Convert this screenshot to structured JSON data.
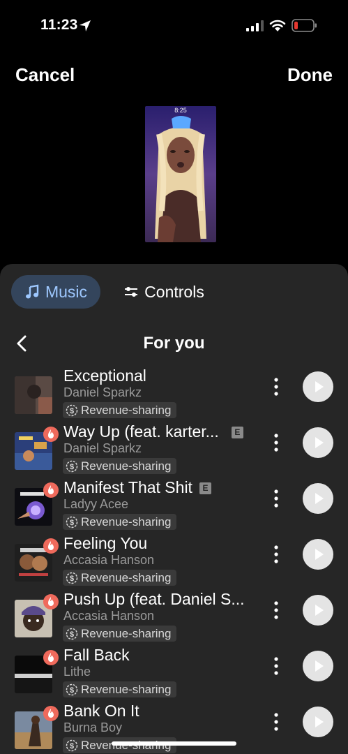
{
  "status_bar": {
    "time": "11:23"
  },
  "header": {
    "cancel_label": "Cancel",
    "done_label": "Done"
  },
  "preview": {
    "clock_text": "8:25"
  },
  "tabs": [
    {
      "label": "Music",
      "icon": "music-note-icon",
      "active": true
    },
    {
      "label": "Controls",
      "icon": "sliders-icon",
      "active": false
    }
  ],
  "list": {
    "title": "For you",
    "tracks": [
      {
        "title": "Exceptional",
        "artist": "Daniel Sparkz",
        "tag": "Revenue-sharing",
        "hot": false,
        "explicit": false
      },
      {
        "title": "Way Up (feat. karter...",
        "artist": "Daniel Sparkz",
        "tag": "Revenue-sharing",
        "hot": true,
        "explicit": true
      },
      {
        "title": "Manifest That Shit",
        "artist": "Ladyy Acee",
        "tag": "Revenue-sharing",
        "hot": true,
        "explicit": true
      },
      {
        "title": "Feeling You",
        "artist": "Accasia Hanson",
        "tag": "Revenue-sharing",
        "hot": true,
        "explicit": false
      },
      {
        "title": "Push Up (feat. Daniel S...",
        "artist": "Accasia Hanson",
        "tag": "Revenue-sharing",
        "hot": true,
        "explicit": false
      },
      {
        "title": "Fall Back",
        "artist": "Lithe",
        "tag": "Revenue-sharing",
        "hot": true,
        "explicit": false
      },
      {
        "title": "Bank On It",
        "artist": "Burna Boy",
        "tag": "Revenue-sharing",
        "hot": true,
        "explicit": false
      }
    ],
    "explicit_label": "E"
  },
  "colors": {
    "background": "#000000",
    "sheet": "#262626",
    "active_tab": "#34455c",
    "active_tab_text": "#9ec8ff",
    "hot_badge": "#ef6a5c",
    "battery_low": "#e5372f"
  }
}
